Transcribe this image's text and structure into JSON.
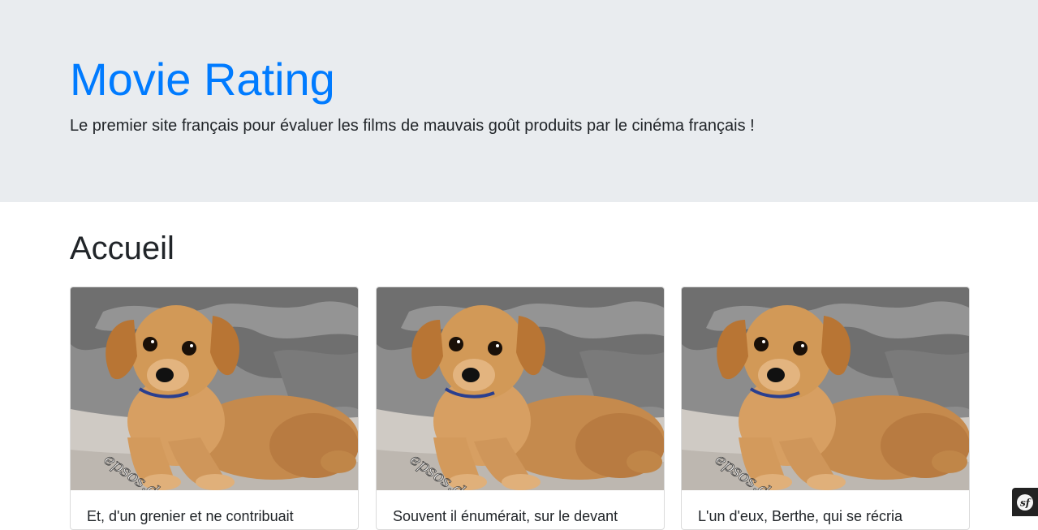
{
  "header": {
    "title": "Movie Rating",
    "lead": "Le premier site français pour évaluer les films de mauvais goût produits par le cinéma français !"
  },
  "main": {
    "heading": "Accueil",
    "cards": [
      {
        "image_icon": "puppy-photo",
        "watermark": "epsos.de",
        "text": "Et, d'un grenier et ne contribuait"
      },
      {
        "image_icon": "puppy-photo",
        "watermark": "epsos.de",
        "text": "Souvent il énumérait, sur le devant"
      },
      {
        "image_icon": "puppy-photo",
        "watermark": "epsos.de",
        "text": "L'un d'eux, Berthe, qui se récria"
      }
    ]
  },
  "toolbar": {
    "icon": "symfony-icon",
    "label": "sf"
  },
  "colors": {
    "accent": "#007bff",
    "jumbotron_bg": "#e9ecef",
    "text": "#212529",
    "toolbar_bg": "#222222"
  }
}
